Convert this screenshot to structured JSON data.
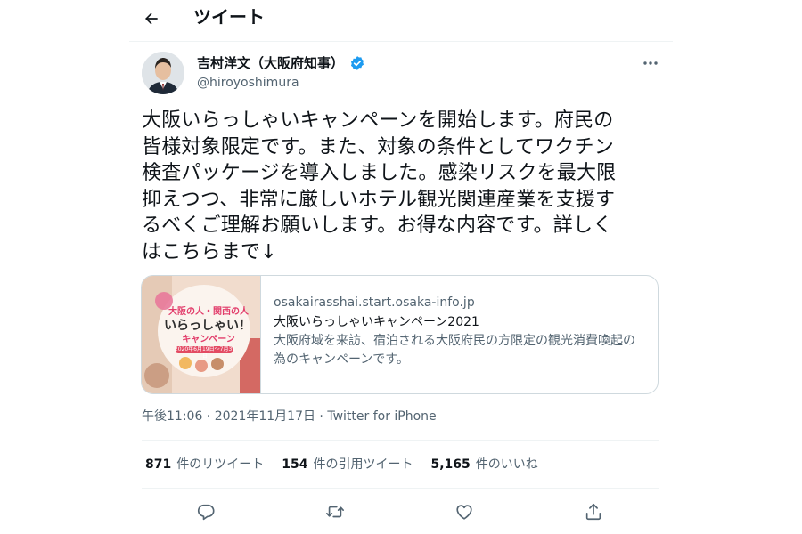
{
  "header": {
    "title": "ツイート"
  },
  "author": {
    "name": "吉村洋文（大阪府知事）",
    "handle": "@hiroyoshimura"
  },
  "tweet": {
    "text": "大阪いらっしゃいキャンペーンを開始します。府民の\n皆様対象限定です。また、対象の条件としてワクチン\n検査パッケージを導入しました。感染リスクを最大限\n抑えつつ、非常に厳しいホテル観光関連産業を支援す\nるべくご理解お願いします。お得な内容です。詳しく\nはこちらまで↓"
  },
  "card": {
    "domain": "osakairasshai.start.osaka-info.jp",
    "title": "大阪いらっしゃいキャンペーン2021",
    "description": "大阪府域を来訪、宿泊される大阪府民の方限定の観光消費喚起の為のキャンペーンです。",
    "thumb": {
      "line1": "大阪の人・関西の人",
      "line2": "いらっしゃい！",
      "line3": "キャンペーン",
      "dates": "2020年6月19日〜7月31日"
    }
  },
  "meta": {
    "time": "午後11:06",
    "sep1": " · ",
    "date": "2021年11月17日",
    "sep2": " · ",
    "source": "Twitter for iPhone"
  },
  "stats": [
    {
      "count": "871",
      "label": "件のリツイート"
    },
    {
      "count": "154",
      "label": "件の引用ツイート"
    },
    {
      "count": "5,165",
      "label": "件のいいね"
    }
  ],
  "colors": {
    "accent": "#1d9bf0",
    "text": "#0f1419",
    "secondary": "#536471",
    "border": "#cfd9de"
  },
  "icons": {
    "back": "arrow-left-icon",
    "verified": "verified-badge-icon",
    "more": "more-horizontal-icon",
    "reply": "reply-icon",
    "retweet": "retweet-icon",
    "like": "heart-icon",
    "share": "share-icon"
  }
}
